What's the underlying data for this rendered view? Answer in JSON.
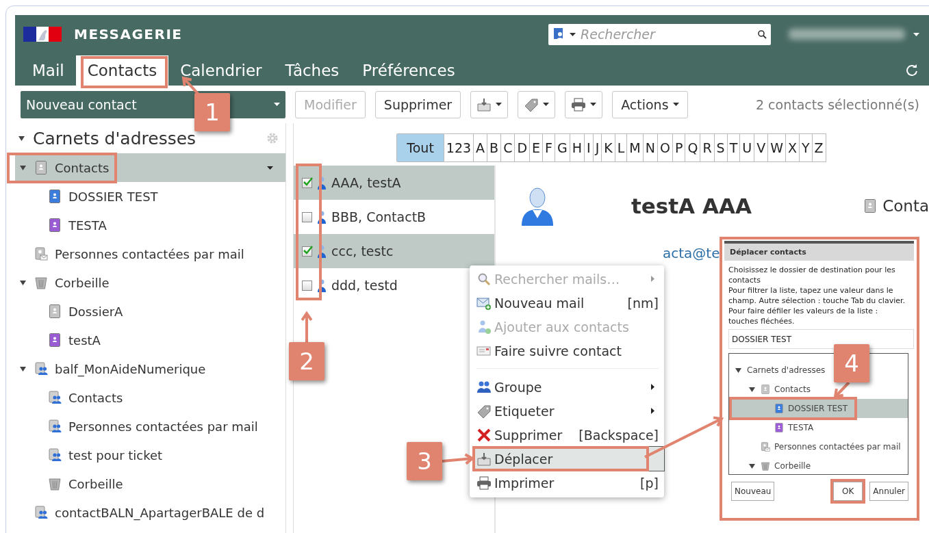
{
  "header": {
    "app_name": "MESSAGERIE",
    "search": {
      "placeholder": "Rechercher"
    }
  },
  "tabs": [
    {
      "label": "Mail",
      "selected": false
    },
    {
      "label": "Contacts",
      "selected": true
    },
    {
      "label": "Calendrier",
      "selected": false
    },
    {
      "label": "Tâches",
      "selected": false
    },
    {
      "label": "Préférences",
      "selected": false
    }
  ],
  "toolbar": {
    "new_contact": "Nouveau contact",
    "buttons": [
      {
        "kind": "text",
        "label": "Modifier",
        "disabled": true,
        "dropdown": false
      },
      {
        "kind": "text",
        "label": "Supprimer",
        "disabled": false,
        "dropdown": false
      },
      {
        "kind": "move",
        "disabled": false,
        "dropdown": true
      },
      {
        "kind": "tag",
        "disabled": false,
        "dropdown": true
      },
      {
        "kind": "print",
        "disabled": false,
        "dropdown": true
      },
      {
        "kind": "text",
        "label": "Actions",
        "disabled": false,
        "dropdown": true
      }
    ],
    "status": "2 contacts sélectionné(s)"
  },
  "sidebar": {
    "title": "Carnets d'adresses",
    "expanded": true,
    "items": [
      {
        "label": "Contacts",
        "kind": "book",
        "color": "#c4c4c4",
        "expanded": true,
        "selected": true,
        "children": [
          {
            "label": "DOSSIER TEST",
            "kind": "book",
            "color": "#3b7ddd",
            "selected": false
          },
          {
            "label": "TESTA",
            "kind": "book",
            "color": "#9b5bd4",
            "selected": false
          }
        ]
      },
      {
        "label": "Personnes contactées par mail",
        "kind": "mail-book",
        "color": "#c4c4c4",
        "selected": false
      },
      {
        "label": "Corbeille",
        "kind": "trash",
        "expanded": true,
        "selected": false,
        "children": [
          {
            "label": "DossierA",
            "kind": "book",
            "color": "#c4c4c4",
            "selected": false
          },
          {
            "label": "testA",
            "kind": "book",
            "color": "#9b5bd4",
            "selected": false
          }
        ]
      },
      {
        "label": "balf_MonAideNumerique",
        "kind": "shared",
        "expanded": true,
        "selected": false,
        "children": [
          {
            "label": "Contacts",
            "kind": "shared",
            "selected": false
          },
          {
            "label": "Personnes contactées par mail",
            "kind": "shared",
            "selected": false
          },
          {
            "label": "test pour ticket",
            "kind": "shared",
            "selected": false
          },
          {
            "label": "Corbeille",
            "kind": "trash",
            "selected": false
          }
        ]
      },
      {
        "label": "contactBALN_ApartagerBALE de d",
        "kind": "shared",
        "selected": false
      }
    ]
  },
  "alphabet": [
    {
      "label": "Tout",
      "selected": true
    },
    {
      "label": "123",
      "selected": false
    },
    {
      "label": "A",
      "selected": false
    },
    {
      "label": "B",
      "selected": false
    },
    {
      "label": "C",
      "selected": false
    },
    {
      "label": "D",
      "selected": false
    },
    {
      "label": "E",
      "selected": false
    },
    {
      "label": "F",
      "selected": false
    },
    {
      "label": "G",
      "selected": false
    },
    {
      "label": "H",
      "selected": false
    },
    {
      "label": "I",
      "selected": false
    },
    {
      "label": "J",
      "selected": false
    },
    {
      "label": "K",
      "selected": false
    },
    {
      "label": "L",
      "selected": false
    },
    {
      "label": "M",
      "selected": false
    },
    {
      "label": "N",
      "selected": false
    },
    {
      "label": "O",
      "selected": false
    },
    {
      "label": "P",
      "selected": false
    },
    {
      "label": "Q",
      "selected": false
    },
    {
      "label": "R",
      "selected": false
    },
    {
      "label": "S",
      "selected": false
    },
    {
      "label": "T",
      "selected": false
    },
    {
      "label": "U",
      "selected": false
    },
    {
      "label": "V",
      "selected": false
    },
    {
      "label": "W",
      "selected": false
    },
    {
      "label": "X",
      "selected": false
    },
    {
      "label": "Y",
      "selected": false
    },
    {
      "label": "Z",
      "selected": false
    }
  ],
  "contacts": [
    {
      "name": "AAA, testA",
      "checked": true,
      "selected": true
    },
    {
      "name": "BBB, ContactB",
      "checked": false,
      "selected": false
    },
    {
      "name": "ccc, testc",
      "checked": true,
      "selected": true
    },
    {
      "name": "ddd, testd",
      "checked": false,
      "selected": false
    }
  ],
  "detail": {
    "name": "testA AAA",
    "book": "Conta",
    "email": "acta@te"
  },
  "context_menu": [
    {
      "kind": "search",
      "label": "Rechercher mails…",
      "disabled": true,
      "submenu": true,
      "selected": false
    },
    {
      "kind": "new-mail",
      "label": "Nouveau mail",
      "shortcut": "[nm]",
      "disabled": false,
      "submenu": false,
      "selected": false
    },
    {
      "kind": "add-contact",
      "label": "Ajouter aux contacts",
      "disabled": true,
      "submenu": false,
      "selected": false
    },
    {
      "kind": "forward",
      "label": "Faire suivre contact",
      "disabled": false,
      "submenu": false,
      "selected": false
    },
    {
      "kind": "separator"
    },
    {
      "kind": "group",
      "label": "Groupe",
      "disabled": false,
      "submenu": true,
      "selected": false
    },
    {
      "kind": "tag",
      "label": "Etiqueter",
      "disabled": false,
      "submenu": true,
      "selected": false
    },
    {
      "kind": "delete",
      "label": "Supprimer",
      "shortcut": "[Backspace]",
      "disabled": false,
      "submenu": false,
      "selected": false
    },
    {
      "kind": "move",
      "label": "Déplacer",
      "disabled": false,
      "submenu": false,
      "selected": true
    },
    {
      "kind": "print",
      "label": "Imprimer",
      "shortcut": "[p]",
      "disabled": false,
      "submenu": false,
      "selected": false
    }
  ],
  "dialog": {
    "title": "Déplacer contacts",
    "message": [
      "Choisissez le dossier de destination pour les contacts",
      "Pour filtrer la liste, tapez une valeur dans le champ. Autre sélection : touche Tab du clavier. Pour faire défiler les valeurs de la liste : touches fléchées."
    ],
    "input_value": "DOSSIER TEST",
    "tree": [
      {
        "label": "Carnets d'adresses",
        "expanded": true,
        "selected": false,
        "children": [
          {
            "label": "Contacts",
            "kind": "book",
            "color": "#c4c4c4",
            "expanded": true,
            "selected": false,
            "children": [
              {
                "label": "DOSSIER TEST",
                "kind": "book",
                "color": "#3b7ddd",
                "selected": true
              },
              {
                "label": "TESTA",
                "kind": "book",
                "color": "#9b5bd4",
                "selected": false
              }
            ]
          },
          {
            "label": "Personnes contactées par mail",
            "kind": "mail-book",
            "color": "#c4c4c4",
            "selected": false
          },
          {
            "label": "Corbeille",
            "kind": "trash",
            "expanded": true,
            "selected": false
          }
        ]
      }
    ],
    "buttons": [
      "Nouveau",
      "OK",
      "Annuler"
    ]
  },
  "annotations": {
    "steps": [
      {
        "label": "1"
      },
      {
        "label": "2"
      },
      {
        "label": "3"
      },
      {
        "label": "4"
      }
    ]
  }
}
